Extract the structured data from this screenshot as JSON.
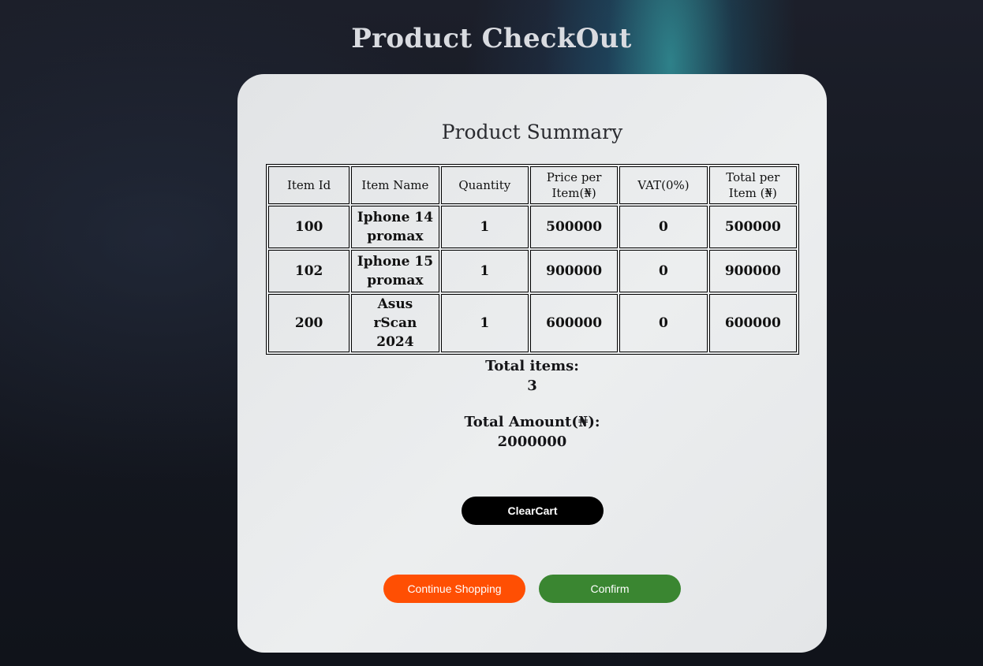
{
  "page": {
    "title": "Product CheckOut"
  },
  "summary": {
    "title": "Product Summary",
    "columns": [
      "Item Id",
      "Item Name",
      "Quantity",
      "Price per Item(₦)",
      "VAT(0%)",
      "Total per Item (₦)"
    ],
    "rows": [
      {
        "id": "100",
        "name": "Iphone 14 promax",
        "quantity": "1",
        "price": "500000",
        "vat": "0",
        "total": "500000"
      },
      {
        "id": "102",
        "name": "Iphone 15 promax",
        "quantity": "1",
        "price": "900000",
        "vat": "0",
        "total": "900000"
      },
      {
        "id": "200",
        "name": "Asus rScan 2024",
        "quantity": "1",
        "price": "600000",
        "vat": "0",
        "total": "600000"
      }
    ]
  },
  "totals": {
    "items_label": "Total items:",
    "items_value": "3",
    "amount_label": "Total Amount(₦):",
    "amount_value": "2000000"
  },
  "buttons": {
    "clear_cart": "ClearCart",
    "continue_shopping": "Continue Shopping",
    "confirm": "Confirm"
  },
  "colors": {
    "clear_cart_bg": "#000000",
    "continue_bg": "#ff4f03",
    "confirm_bg": "#3a8631"
  }
}
